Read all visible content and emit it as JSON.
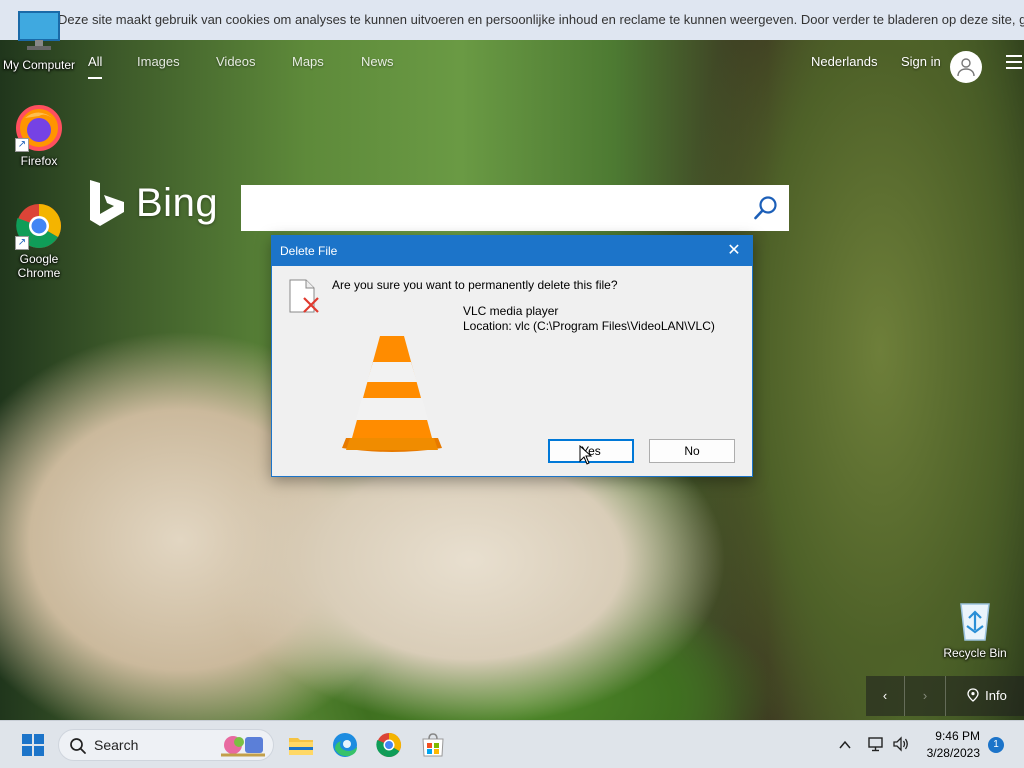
{
  "cookie_banner": {
    "text": "Deze site maakt gebruik van cookies om analyses te kunnen uitvoeren en persoonlijke inhoud en reclame te kunnen weergeven. Door verder te bladeren op deze site, gaat u"
  },
  "bing": {
    "nav": [
      {
        "label": "All"
      },
      {
        "label": "Images"
      },
      {
        "label": "Videos"
      },
      {
        "label": "Maps"
      },
      {
        "label": "News"
      }
    ],
    "language": "Nederlands",
    "sign_in": "Sign in",
    "logo_word": "Bing",
    "search": {
      "value": "",
      "placeholder": ""
    },
    "photo_info": "Info"
  },
  "desktop_icons": [
    {
      "label": "My Computer",
      "icon": "computer-icon"
    },
    {
      "label": "Firefox",
      "icon": "firefox-icon"
    },
    {
      "label": "Google Chrome",
      "icon": "chrome-icon"
    },
    {
      "label": "Recycle Bin",
      "icon": "recycle-bin-icon"
    }
  ],
  "dialog": {
    "title": "Delete File",
    "question": "Are you sure you want to permanently delete this file?",
    "file_name": "VLC media player",
    "file_location": "Location: vlc (C:\\Program Files\\VideoLAN\\VLC)",
    "yes_label": "Yes",
    "no_label": "No"
  },
  "taskbar": {
    "search_label": "Search",
    "time": "9:46 PM",
    "date": "3/28/2023",
    "notification_count": "1"
  },
  "colors": {
    "dialog_accent": "#1c74c9",
    "taskbar_bg": "#dfe4ea",
    "cookie_bg": "#dfe6f1"
  }
}
